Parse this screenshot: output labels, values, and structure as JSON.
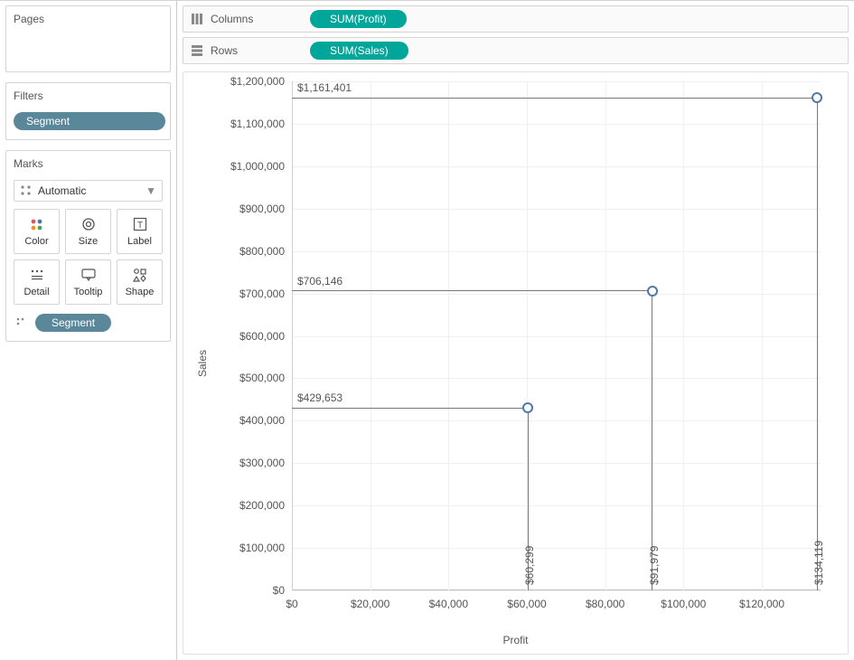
{
  "panels": {
    "pages": {
      "title": "Pages"
    },
    "filters": {
      "title": "Filters",
      "pill": "Segment"
    },
    "marks": {
      "title": "Marks",
      "type_label": "Automatic",
      "buttons": {
        "color": "Color",
        "size": "Size",
        "label": "Label",
        "detail": "Detail",
        "tooltip": "Tooltip",
        "shape": "Shape"
      },
      "detail_pill": "Segment"
    }
  },
  "shelves": {
    "columns": {
      "label": "Columns",
      "pill": "SUM(Profit)"
    },
    "rows": {
      "label": "Rows",
      "pill": "SUM(Sales)"
    }
  },
  "axes": {
    "y": {
      "label": "Sales",
      "min": 0,
      "max": 1200000,
      "step": 100000,
      "prefix": "$"
    },
    "x": {
      "label": "Profit",
      "min": 0,
      "max": 120000,
      "step": 20000,
      "prefix": "$"
    }
  },
  "chart_data": {
    "type": "scatter",
    "xlabel": "Profit",
    "ylabel": "Sales",
    "xlim": [
      0,
      135000
    ],
    "ylim": [
      0,
      1200000
    ],
    "series": [
      {
        "name": "Segment",
        "points": [
          {
            "profit": 60299,
            "sales": 429653,
            "profit_label": "$60,299",
            "sales_label": "$429,653"
          },
          {
            "profit": 91979,
            "sales": 706146,
            "profit_label": "$91,979",
            "sales_label": "$706,146"
          },
          {
            "profit": 134119,
            "sales": 1161401,
            "profit_label": "$134,119",
            "sales_label": "$1,161,401"
          }
        ]
      }
    ]
  }
}
